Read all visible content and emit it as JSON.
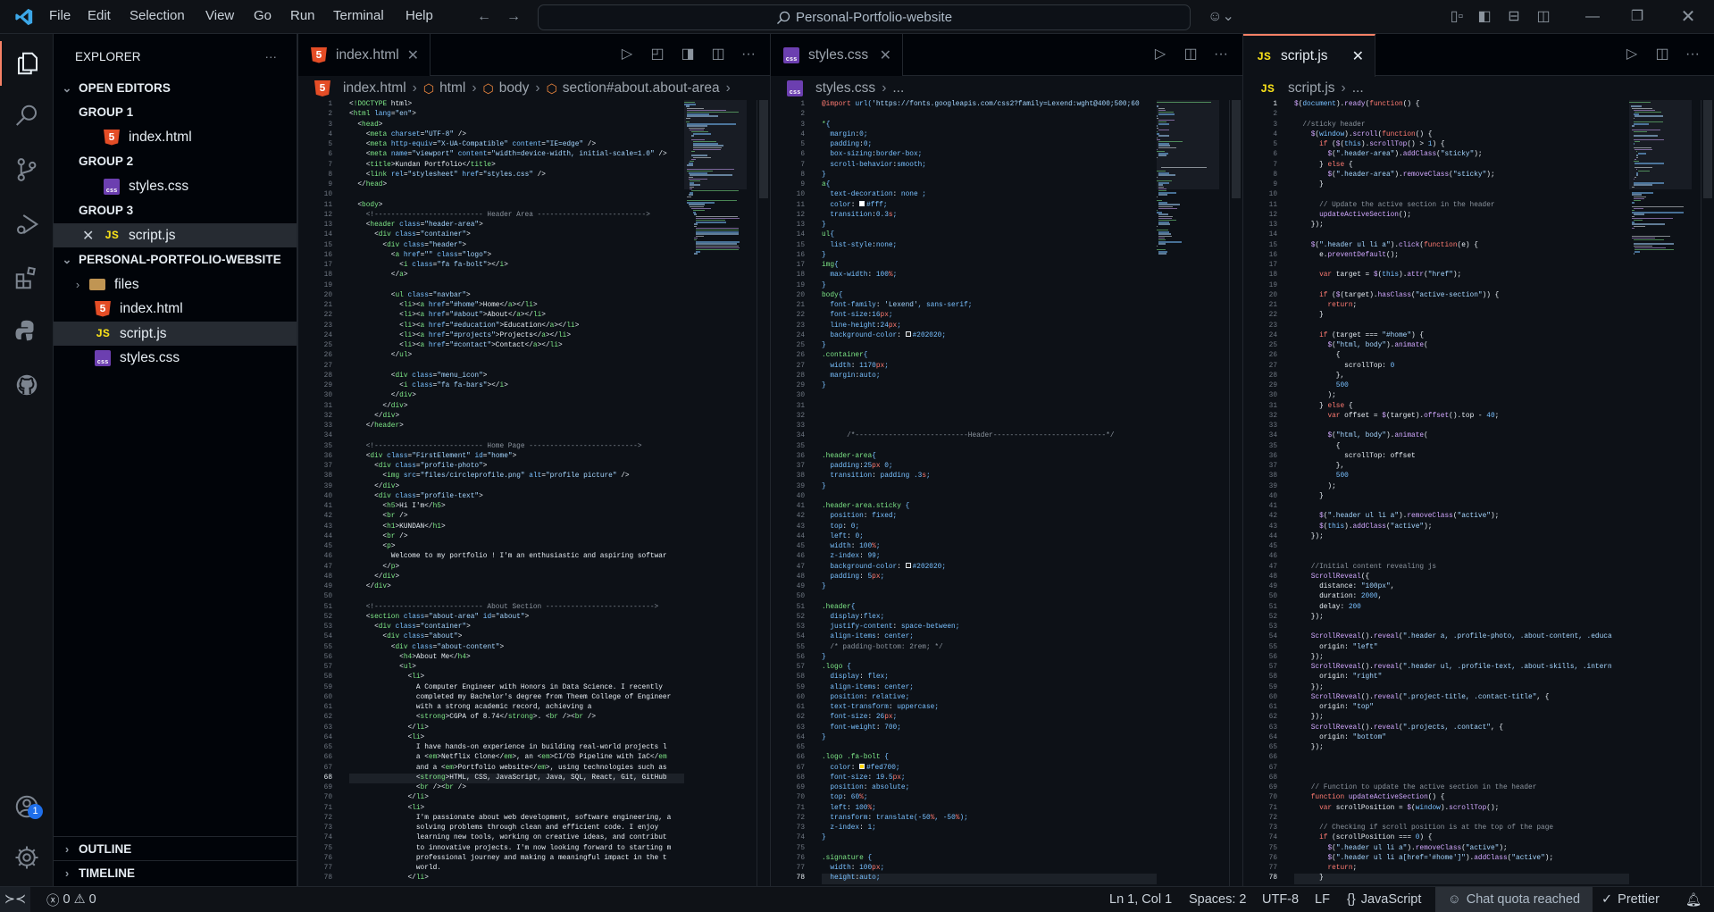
{
  "titlebar": {
    "menu": [
      "File",
      "Edit",
      "Selection",
      "View",
      "Go",
      "Run",
      "Terminal",
      "Help"
    ],
    "search": "Personal-Portfolio-website"
  },
  "sidebar": {
    "title": "EXPLORER",
    "more": "···",
    "open_editors": "OPEN EDITORS",
    "groups": [
      {
        "label": "GROUP 1",
        "file": "index.html",
        "type": "html"
      },
      {
        "label": "GROUP 2",
        "file": "styles.css",
        "type": "css"
      },
      {
        "label": "GROUP 3",
        "file": "script.js",
        "type": "js"
      }
    ],
    "project": "PERSONAL-PORTFOLIO-WEBSITE",
    "tree": [
      {
        "name": "files",
        "type": "folder"
      },
      {
        "name": "index.html",
        "type": "html"
      },
      {
        "name": "script.js",
        "type": "js",
        "selected": true
      },
      {
        "name": "styles.css",
        "type": "css"
      }
    ],
    "outline": "OUTLINE",
    "timeline": "TIMELINE",
    "accounts_badge": "1"
  },
  "editors": [
    {
      "tab": "index.html",
      "type": "html",
      "active": false,
      "breadcrumbs": [
        "index.html",
        "html",
        "body",
        "section#about.about-area"
      ],
      "current_line": 68,
      "lines": [
        "<!DOCTYPE html>",
        "<html lang=\"en\">",
        "  <head>",
        "    <meta charset=\"UTF-8\" />",
        "    <meta http-equiv=\"X-UA-Compatible\" content=\"IE=edge\" />",
        "    <meta name=\"viewport\" content=\"width=device-width, initial-scale=1.0\" />",
        "    <title>Kundan Portfolio</title>",
        "    <link rel=\"stylesheet\" href=\"styles.css\" />",
        "  </head>",
        "",
        "  <body>",
        "    <!-------------------------- Header Area -------------------------->",
        "    <header class=\"header-area\">",
        "      <div class=\"container\">",
        "        <div class=\"header\">",
        "          <a href=\"\" class=\"logo\">",
        "            <i class=\"fa fa-bolt\"></i>",
        "          </a>",
        "",
        "          <ul class=\"navbar\">",
        "            <li><a href=\"#home\">Home</a></li>",
        "            <li><a href=\"#about\">About</a></li>",
        "            <li><a href=\"#education\">Education</a></li>",
        "            <li><a href=\"#projects\">Projects</a></li>",
        "            <li><a href=\"#contact\">Contact</a></li>",
        "          </ul>",
        "",
        "          <div class=\"menu_icon\">",
        "            <i class=\"fa fa-bars\"></i>",
        "          </div>",
        "        </div>",
        "      </div>",
        "    </header>",
        "",
        "    <!-------------------------- Home Page -------------------------->",
        "    <div class=\"FirstElement\" id=\"home\">",
        "      <div class=\"profile-photo\">",
        "        <img src=\"files/circleprofile.png\" alt=\"profile picture\" />",
        "      </div>",
        "      <div class=\"profile-text\">",
        "        <h5>Hi I'm</h5>",
        "        <br />",
        "        <h1>KUNDAN</h1>",
        "        <br />",
        "        <p>",
        "          Welcome to my portfolio ! I'm an enthusiastic and aspiring softwar",
        "        </p>",
        "      </div>",
        "    </div>",
        "",
        "    <!-------------------------- About Section -------------------------->",
        "    <section class=\"about-area\" id=\"about\">",
        "      <div class=\"container\">",
        "        <div class=\"about\">",
        "          <div class=\"about-content\">",
        "            <h4>About Me</h4>",
        "            <ul>",
        "              <li>",
        "                A Computer Engineer with Honors in Data Science. I recently",
        "                completed my Bachelor's degree from Theem College of Engineer",
        "                with a strong academic record, achieving a",
        "                <strong>CGPA of 8.74</strong>. <br /><br />",
        "              </li>",
        "              <li>",
        "                I have hands-on experience in building real-world projects l",
        "                a <em>Netflix Clone</em>, an <em>CI/CD Pipeline with IaC</em",
        "                and a <em>Portfolio website</em>, using technologies such as",
        "                <strong>HTML, CSS, JavaScript, Java, SQL, React, Git, GitHub",
        "                <br /><br />",
        "              </li>",
        "              <li>",
        "                I'm passionate about web development, software engineering, a",
        "                solving problems through clean and efficient code. I enjoy",
        "                learning new tools, working on creative ideas, and contribut",
        "                to innovative projects. I'm now looking forward to starting m",
        "                professional journey and making a meaningful impact in the t",
        "                world.",
        "              </li>"
      ]
    },
    {
      "tab": "styles.css",
      "type": "css",
      "active": false,
      "breadcrumbs": [
        "styles.css",
        "..."
      ],
      "current_line": 78,
      "lines": [
        "@import url('https://fonts.googleapis.com/css2?family=Lexend:wght@400;500;60",
        "",
        "*{",
        "  margin:0;",
        "  padding:0;",
        "  box-sizing:border-box;",
        "  scroll-behavior:smooth;",
        "}",
        "a{",
        "  text-decoration: none ;",
        "  color: #fff;",
        "  transition:0.3s;",
        "}",
        "ul{",
        "  list-style:none;",
        "}",
        "img{",
        "  max-width: 100%;",
        "}",
        "body{",
        "  font-family: 'Lexend', sans-serif;",
        "  font-size:16px;",
        "  line-height:24px;",
        "  background-color: #202020;",
        "}",
        ".container{",
        "  width: 1170px;",
        "  margin:auto;",
        "}",
        "",
        "",
        "",
        "",
        "      /*---------------------------Header---------------------------*/",
        "",
        ".header-area{",
        "  padding:25px 0;",
        "  transition: padding .3s;",
        "}",
        "",
        ".header-area.sticky {",
        "  position: fixed;",
        "  top: 0;",
        "  left: 0;",
        "  width: 100%;",
        "  z-index: 99;",
        "  background-color: #202020;",
        "  padding: 5px;",
        "}",
        "",
        ".header{",
        "  display:flex;",
        "  justify-content: space-between;",
        "  align-items: center;",
        "  /* padding-bottom: 2rem; */",
        "}",
        ".logo {",
        "  display: flex;",
        "  align-items: center;",
        "  position: relative;",
        "  text-transform: uppercase;",
        "  font-size: 26px;",
        "  font-weight: 700;",
        "}",
        "",
        ".logo .fa-bolt {",
        "  color: #fed700;",
        "  font-size: 19.5px;",
        "  position: absolute;",
        "  top: 60%;",
        "  left: 100%;",
        "  transform: translate(-50%, -50%);",
        "  z-index: 1;",
        "}",
        "",
        ".signature {",
        "  width: 100px;",
        "  height:auto;"
      ]
    },
    {
      "tab": "script.js",
      "type": "js",
      "active": true,
      "breadcrumbs": [
        "script.js",
        "..."
      ],
      "current_line": 78,
      "lines": [
        "$(document).ready(function() {",
        "",
        "  //sticky header",
        "    $(window).scroll(function() {",
        "      if ($(this).scrollTop() > 1) {",
        "        $(\".header-area\").addClass(\"sticky\");",
        "      } else {",
        "        $(\".header-area\").removeClass(\"sticky\");",
        "      }",
        "",
        "      // Update the active section in the header",
        "      updateActiveSection();",
        "    });",
        "",
        "    $(\".header ul li a\").click(function(e) {",
        "      e.preventDefault();",
        "",
        "      var target = $(this).attr(\"href\");",
        "",
        "      if ($(target).hasClass(\"active-section\")) {",
        "        return;",
        "      }",
        "",
        "      if (target === \"#home\") {",
        "        $(\"html, body\").animate(",
        "          {",
        "            scrollTop: 0",
        "          },",
        "          500",
        "        );",
        "      } else {",
        "        var offset = $(target).offset().top - 40;",
        "",
        "        $(\"html, body\").animate(",
        "          {",
        "            scrollTop: offset",
        "          },",
        "          500",
        "        );",
        "      }",
        "",
        "      $(\".header ul li a\").removeClass(\"active\");",
        "      $(this).addClass(\"active\");",
        "    });",
        "",
        "",
        "    //Initial content revealing js",
        "    ScrollReveal({",
        "      distance: \"100px\",",
        "      duration: 2000,",
        "      delay: 200",
        "    });",
        "",
        "    ScrollReveal().reveal(\".header a, .profile-photo, .about-content, .educa",
        "      origin: \"left\"",
        "    });",
        "    ScrollReveal().reveal(\".header ul, .profile-text, .about-skills, .intern",
        "      origin: \"right\"",
        "    });",
        "    ScrollReveal().reveal(\".project-title, .contact-title\", {",
        "      origin: \"top\"",
        "    });",
        "    ScrollReveal().reveal(\".projects, .contact\", {",
        "      origin: \"bottom\"",
        "    });",
        "",
        "",
        "",
        "    // Function to update the active section in the header",
        "    function updateActiveSection() {",
        "      var scrollPosition = $(window).scrollTop();",
        "",
        "      // Checking if scroll position is at the top of the page",
        "      if (scrollPosition === 0) {",
        "        $(\".header ul li a\").removeClass(\"active\");",
        "        $(\".header ul li a[href='#home']\").addClass(\"active\");",
        "        return;",
        "      }"
      ]
    }
  ],
  "statusbar": {
    "errors": "0",
    "warnings": "0",
    "position": "Ln 1, Col 1",
    "spaces": "Spaces: 2",
    "encoding": "UTF-8",
    "eol": "LF",
    "language": "JavaScript",
    "chat": "Chat quota reached",
    "formatter": "Prettier"
  },
  "colors": {
    "accent": "#f78166",
    "badge": "#1f6feb",
    "editor_bg": "#0d1117",
    "sidebar_bg": "#010409",
    "tag": "#7ee787",
    "attr": "#79c0ff",
    "string": "#a5d6ff",
    "keyword": "#ff7b72",
    "function": "#d2a8ff",
    "comment": "#8b949e"
  }
}
